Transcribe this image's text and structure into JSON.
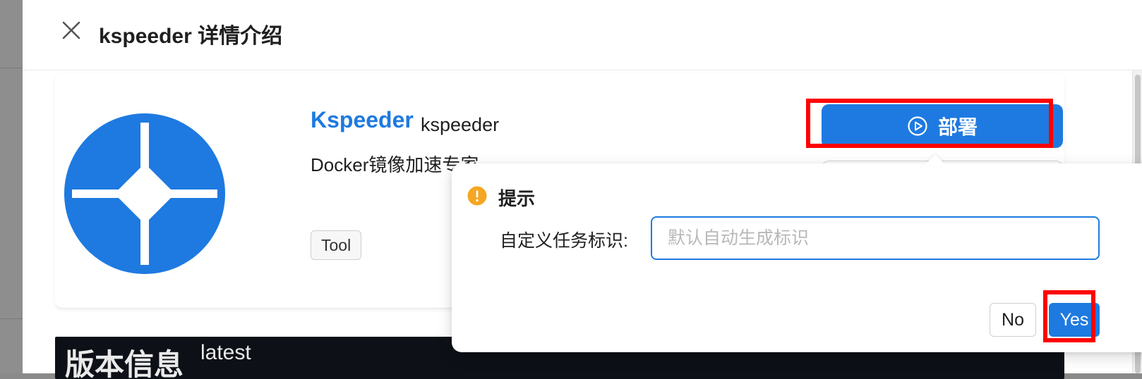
{
  "drawer": {
    "title": "kspeeder 详情介绍"
  },
  "app": {
    "name": "Kspeeder",
    "id": "kspeeder",
    "description": "Docker镜像加速专家",
    "tag": "Tool"
  },
  "actions": {
    "deploy_label": "部署"
  },
  "version": {
    "title": "版本信息",
    "tag": "latest"
  },
  "popconfirm": {
    "title": "提示",
    "field_label": "自定义任务标识:",
    "input_value": "",
    "input_placeholder": "默认自动生成标识",
    "cancel_label": "No",
    "confirm_label": "Yes"
  },
  "icons": {
    "close": "close-icon",
    "logo": "kspeeder-logo",
    "deploy": "play-circle-icon",
    "warning": "exclamation-circle-icon"
  },
  "colors": {
    "primary": "#1e7ae0",
    "warning": "#f5a623",
    "highlight": "#ff0000",
    "version_bar": "#0d1117"
  }
}
